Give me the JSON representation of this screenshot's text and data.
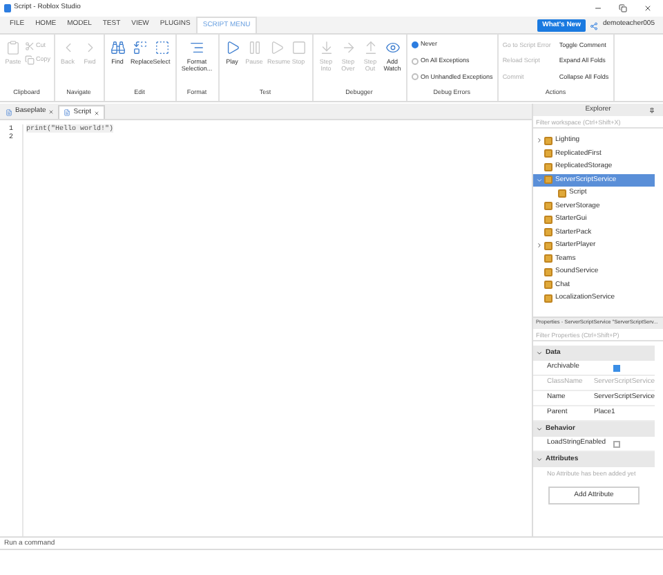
{
  "window": {
    "title": "Script - Roblox Studio"
  },
  "menu_tabs": [
    {
      "label": "FILE",
      "selected": false
    },
    {
      "label": "HOME",
      "selected": false
    },
    {
      "label": "MODEL",
      "selected": false
    },
    {
      "label": "TEST",
      "selected": false
    },
    {
      "label": "VIEW",
      "selected": false
    },
    {
      "label": "PLUGINS",
      "selected": false
    },
    {
      "label": "SCRIPT MENU",
      "selected": true
    }
  ],
  "whats_new": "What's New",
  "user": "demoteacher005",
  "ribbon": [
    {
      "name": "Clipboard",
      "items": [
        {
          "label": "Paste",
          "disabled": true
        },
        {
          "label": "Cut",
          "disabled": true
        },
        {
          "label": "Copy",
          "disabled": true
        }
      ]
    },
    {
      "name": "Navigate",
      "items": [
        {
          "label": "Back",
          "disabled": true
        },
        {
          "label": "Fwd",
          "disabled": true
        }
      ]
    },
    {
      "name": "Edit",
      "items": [
        {
          "label": "Find",
          "disabled": false
        },
        {
          "label": "Replace",
          "disabled": false
        },
        {
          "label": "Select",
          "disabled": false
        }
      ]
    },
    {
      "name": "Format",
      "items": [
        {
          "label": "Format Selection...",
          "disabled": false
        }
      ]
    },
    {
      "name": "Test",
      "items": [
        {
          "label": "Play",
          "disabled": false
        },
        {
          "label": "Pause",
          "disabled": true
        },
        {
          "label": "Resume",
          "disabled": true
        },
        {
          "label": "Stop",
          "disabled": true
        }
      ]
    },
    {
      "name": "Debugger",
      "items": [
        {
          "label": "Step Into",
          "disabled": true
        },
        {
          "label": "Step Over",
          "disabled": true
        },
        {
          "label": "Step Out",
          "disabled": true
        },
        {
          "label": "Add Watch",
          "disabled": false
        }
      ]
    }
  ],
  "debug_errors": {
    "name": "Debug Errors",
    "options": [
      {
        "label": "Never",
        "selected": true
      },
      {
        "label": "On All Exceptions",
        "selected": false
      },
      {
        "label": "On Unhandled Exceptions",
        "selected": false
      }
    ]
  },
  "actions": {
    "name": "Actions",
    "items": [
      {
        "label": "Go to Script Error",
        "disabled": true
      },
      {
        "label": "Reload Script",
        "disabled": true
      },
      {
        "label": "Commit",
        "disabled": true
      },
      {
        "label": "Toggle Comment",
        "disabled": false
      },
      {
        "label": "Expand All Folds",
        "disabled": false
      },
      {
        "label": "Collapse All Folds",
        "disabled": false
      }
    ]
  },
  "doc_tabs": [
    {
      "label": "Baseplate",
      "selected": false
    },
    {
      "label": "Script",
      "selected": true
    }
  ],
  "editor": {
    "lines": [
      {
        "number": "1",
        "code": "print(\"Hello world!\")"
      },
      {
        "number": "2"
      }
    ]
  },
  "explorer": {
    "title": "Explorer",
    "placeholder": "Filter workspace (Ctrl+Shift+X)",
    "items": [
      {
        "label": "Lighting",
        "expanded": false,
        "selected": false
      },
      {
        "label": "ReplicatedFirst",
        "selected": false
      },
      {
        "label": "ReplicatedStorage",
        "selected": false
      },
      {
        "label": "ServerScriptService",
        "expanded": true,
        "selected": true,
        "children": [
          {
            "label": "Script",
            "selected": false
          }
        ]
      },
      {
        "label": "ServerStorage",
        "selected": false
      },
      {
        "label": "StarterGui",
        "selected": false
      },
      {
        "label": "StarterPack",
        "selected": false
      },
      {
        "label": "StarterPlayer",
        "expanded": false,
        "selected": false
      },
      {
        "label": "Teams",
        "selected": false
      },
      {
        "label": "SoundService",
        "selected": false
      },
      {
        "label": "Chat",
        "selected": false
      },
      {
        "label": "LocalizationService",
        "selected": false
      }
    ]
  },
  "properties": {
    "title": "Properties - ServerScriptService \"ServerScriptServ...",
    "placeholder": "Filter Properties (Ctrl+Shift+P)",
    "sections": [
      {
        "name": "Data",
        "rows": [
          {
            "kind": "checkbox",
            "label": "Archivable",
            "checked": true
          },
          {
            "kind": "text",
            "label": "ClassName",
            "value": "ServerScriptService",
            "disabled": true
          },
          {
            "kind": "text",
            "label": "Name",
            "value": "ServerScriptService",
            "disabled": false
          },
          {
            "kind": "text",
            "label": "Parent",
            "value": "Place1",
            "disabled": false
          }
        ]
      },
      {
        "name": "Behavior",
        "rows": [
          {
            "kind": "checkbox",
            "label": "LoadStringEnabled",
            "checked": false
          }
        ]
      },
      {
        "name": "Attributes",
        "rows": [
          {
            "kind": "note",
            "label": "No Attribute has been added yet"
          },
          {
            "kind": "button",
            "label": "Add Attribute"
          }
        ]
      }
    ]
  },
  "command_bar": {
    "placeholder": "Run a command"
  }
}
